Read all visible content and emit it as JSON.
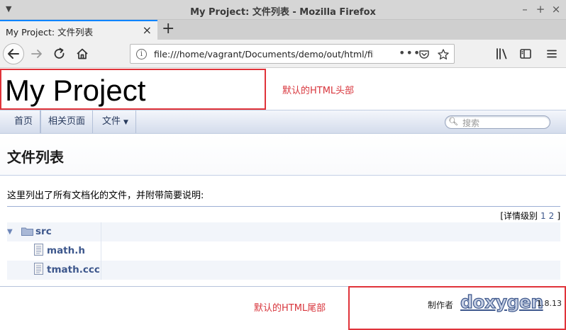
{
  "window": {
    "title": "My Project: 文件列表 - Mozilla Firefox",
    "minimize": "–",
    "maximize": "+",
    "close": "×"
  },
  "tab": {
    "label": "My Project: 文件列表",
    "close": "×",
    "new_tab": "+"
  },
  "urlbar": {
    "url": "file:///home/vagrant/Documents/demo/out/html/files.ht",
    "page_actions": "•••"
  },
  "header": {
    "project_name": "My Project",
    "annotation": "默认的HTML头部"
  },
  "doxygen_nav": {
    "items": [
      {
        "label": "首页"
      },
      {
        "label": "相关页面"
      },
      {
        "label": "文件"
      }
    ],
    "search_placeholder": "搜索"
  },
  "content": {
    "title": "文件列表",
    "description": "这里列出了所有文档化的文件，并附带简要说明:",
    "detail_level_label": "[详情级别",
    "detail_levels": [
      "1",
      "2"
    ],
    "detail_level_close": "]",
    "tree": [
      {
        "name": "src",
        "type": "folder",
        "expanded": true
      },
      {
        "name": "math.h",
        "type": "file"
      },
      {
        "name": "tmath.ccc",
        "type": "file"
      }
    ]
  },
  "footer": {
    "annotation": "默认的HTML尾部",
    "made_by": "制作者",
    "logo": "doxygen",
    "version": "1.8.13"
  },
  "colors": {
    "annotation_red": "#e0333a",
    "doxygen_link": "#3d578c",
    "firefox_accent": "#0a84ff"
  }
}
